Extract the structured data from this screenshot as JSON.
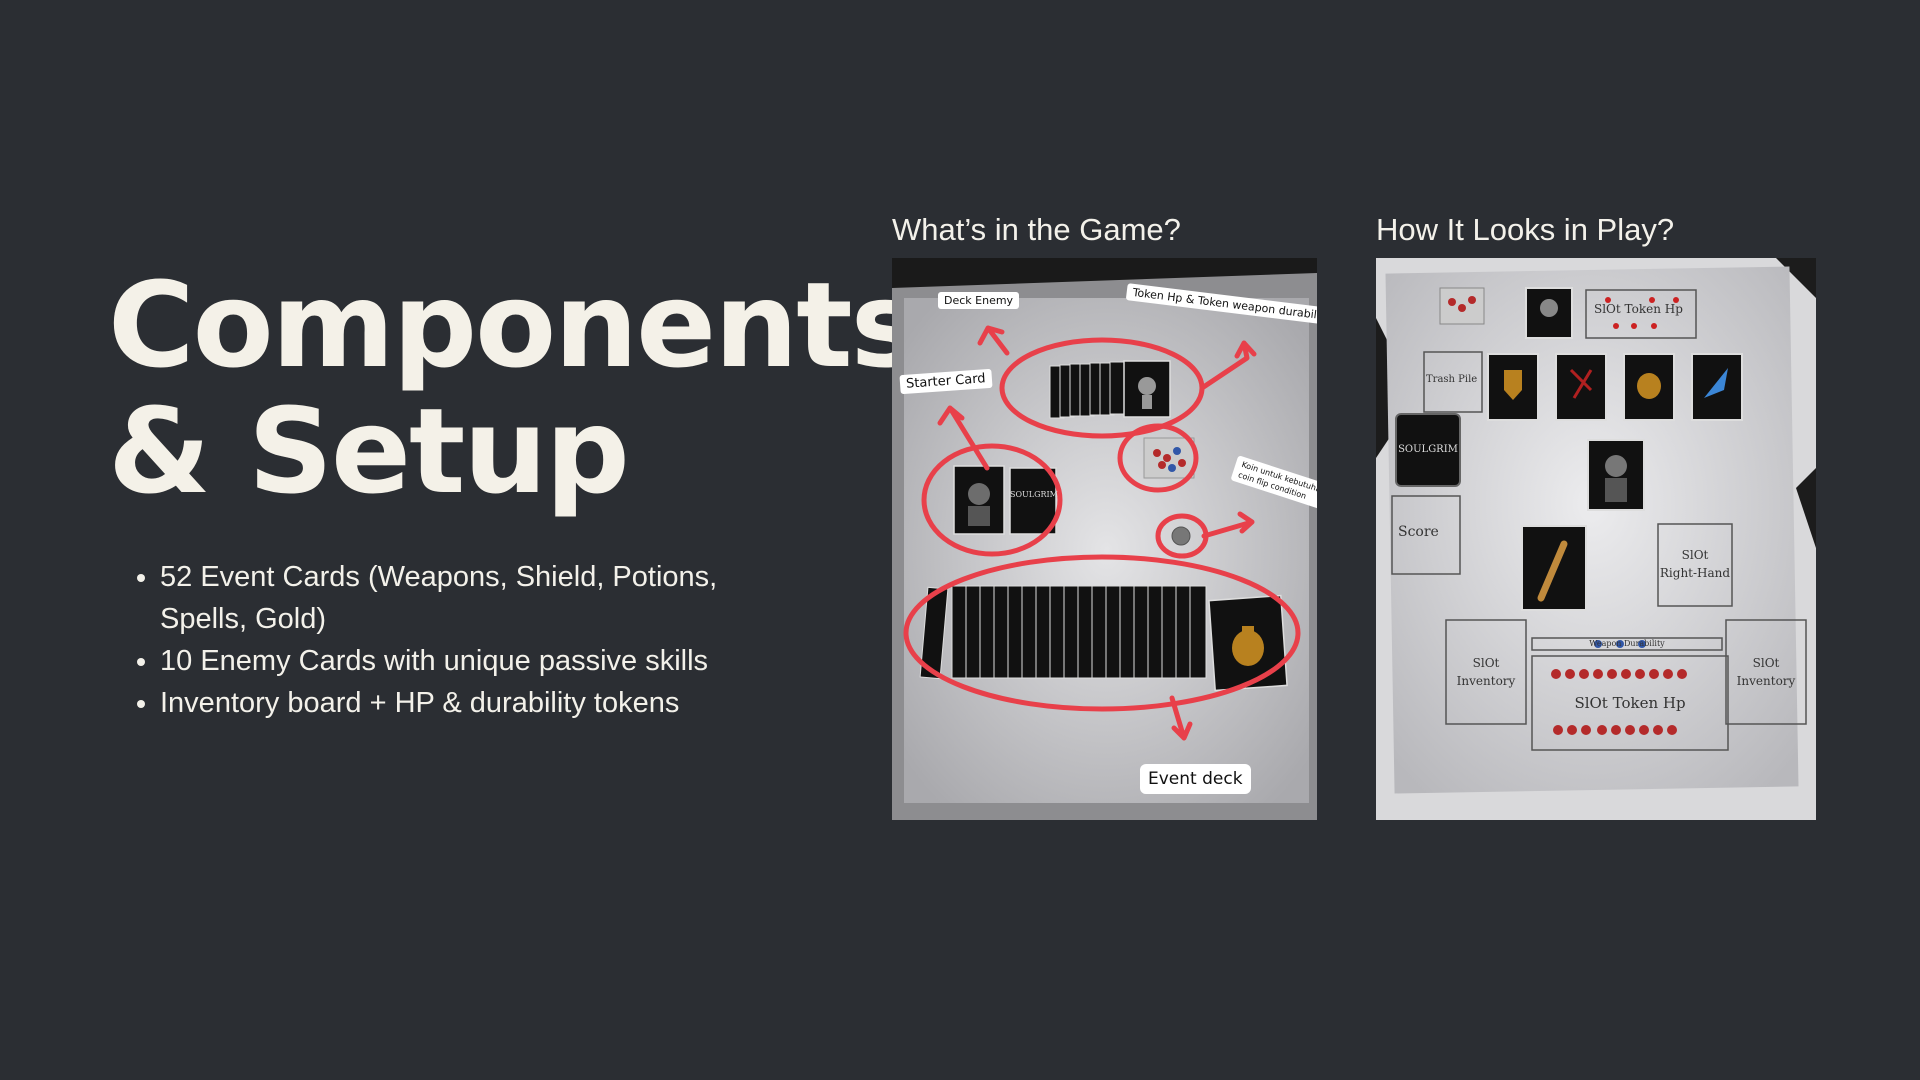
{
  "slide": {
    "title_line1": "Components",
    "title_line2": "& Setup",
    "bullets": [
      "52 Event Cards (Weapons, Shield, Potions, Spells, Gold)",
      "10 Enemy Cards with unique passive skills",
      "Inventory board + HP & durability tokens"
    ]
  },
  "left_panel": {
    "caption": "What’s in the Game?",
    "labels": {
      "deck_enemy": "Deck Enemy",
      "starter_card": "Starter Card",
      "token_hp": "Token Hp & Token weapon durability",
      "coin_note_1": "Koin untuk kebutuhan",
      "coin_note_2": "coin flip condition",
      "event_deck": "Event deck",
      "soulgrim": "SOULGRIM"
    }
  },
  "right_panel": {
    "caption": "How It Looks in Play?",
    "labels": {
      "slot_token_hp_top": "SlOt Token Hp",
      "trash_pile": "Trash Pile",
      "soulgrim": "SOULGRIM",
      "score": "Score",
      "slot_right_hand_1": "SlOt",
      "slot_right_hand_2": "Right-Hand",
      "slot_inventory_left_1": "SlOt",
      "slot_inventory_left_2": "Inventory",
      "slot_inventory_right_1": "SlOt",
      "slot_inventory_right_2": "Inventory",
      "weapon_durability": "Weapon Durability",
      "slot_token_hp_bottom": "SlOt Token Hp"
    }
  },
  "colors": {
    "background": "#2b2e33",
    "text": "#f3f1ea",
    "annotation_red": "#e8404a"
  }
}
